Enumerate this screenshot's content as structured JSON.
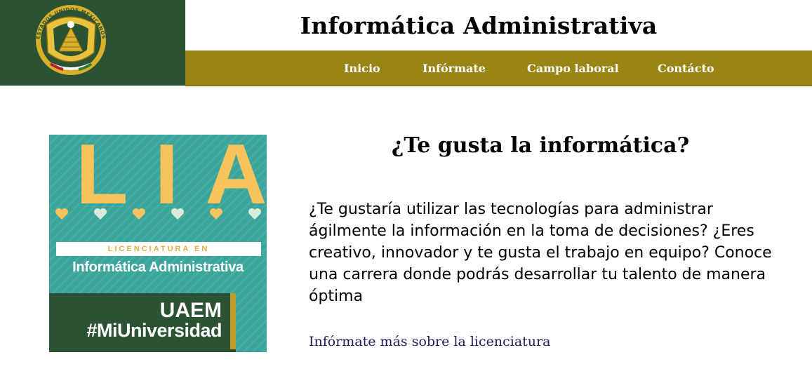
{
  "header": {
    "logo_text": "ESTADOS UNIDOS MEXICANOS",
    "title": "Informática Administrativa"
  },
  "nav": {
    "items": [
      {
        "label": "Inicio"
      },
      {
        "label": "Infórmate"
      },
      {
        "label": "Campo laboral"
      },
      {
        "label": "Contácto"
      }
    ]
  },
  "poster": {
    "big_text": "LIA",
    "band_text": "LICENCIATURA EN",
    "program_name": "Informática Administrativa",
    "university": "UAEM",
    "hashtag": "#MiUniversidad"
  },
  "main": {
    "heading": "¿Te gusta la informática?",
    "paragraph": "¿Te gustaría utilizar las tecnologías para administrar ágilmente la información en la toma de decisiones? ¿Eres creativo, innovador y te gusta el trabajo en equipo? Conoce una carrera donde podrás desarrollar tu talento de manera óptima",
    "link_label": "Infórmate más sobre la licenciatura"
  },
  "colors": {
    "header_green": "#2c5234",
    "nav_gold": "#9a8413",
    "poster_teal": "#3aa59b",
    "poster_yellow": "#f7c35a",
    "link_navy": "#1c1c5e"
  }
}
